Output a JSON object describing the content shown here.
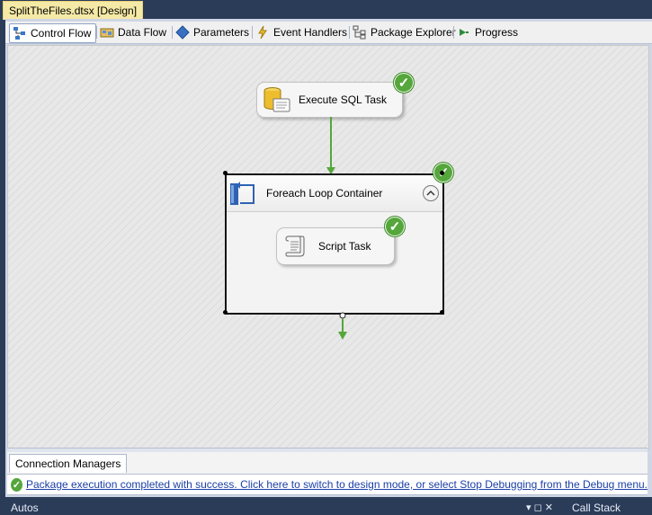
{
  "document_tab": {
    "title": "SplitTheFiles.dtsx [Design]",
    "close_label": "×"
  },
  "designer_tabs": [
    {
      "label": "Control Flow",
      "icon": "control-flow-icon",
      "active": true
    },
    {
      "label": "Data Flow",
      "icon": "data-flow-icon",
      "active": false
    },
    {
      "label": "Parameters",
      "icon": "parameters-icon",
      "active": false
    },
    {
      "label": "Event Handlers",
      "icon": "event-handlers-icon",
      "active": false
    },
    {
      "label": "Package Explorer",
      "icon": "package-explorer-icon",
      "active": false
    },
    {
      "label": "Progress",
      "icon": "progress-icon",
      "active": false
    }
  ],
  "canvas": {
    "execute_sql_task": {
      "label": "Execute SQL Task",
      "status": "success"
    },
    "foreach_container": {
      "label": "Foreach Loop Container",
      "status": "success",
      "collapse_glyph": "⌃"
    },
    "script_task": {
      "label": "Script Task",
      "status": "success"
    }
  },
  "connection_managers": {
    "tab_label": "Connection Managers"
  },
  "status": {
    "message": "Package execution completed with success. Click here to switch to design mode, or select Stop Debugging from the Debug menu."
  },
  "bottom_panels": {
    "left_title": "Autos",
    "right_title": "Call Stack"
  },
  "colors": {
    "success": "#55a63b",
    "precedence_arrow": "#55a63b",
    "document_tab": "#f5e9a6",
    "frame_bg": "#2b3c59"
  }
}
